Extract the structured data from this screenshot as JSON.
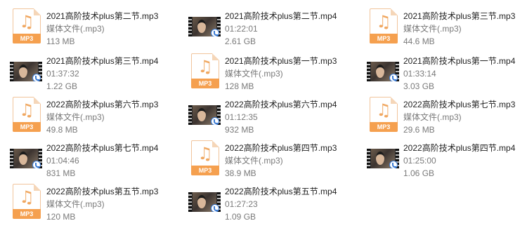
{
  "files": [
    {
      "name": "2021高阶技术plus第二节.mp3",
      "detail": "媒体文件(.mp3)",
      "size": "113 MB",
      "kind": "mp3",
      "icon_label": "MP3"
    },
    {
      "name": "2021高阶技术plus第二节.mp4",
      "detail": "01:22:01",
      "size": "2.61 GB",
      "kind": "mp4"
    },
    {
      "name": "2021高阶技术plus第三节.mp3",
      "detail": "媒体文件(.mp3)",
      "size": "44.6 MB",
      "kind": "mp3",
      "icon_label": "MP3"
    },
    {
      "name": "2021高阶技术plus第三节.mp4",
      "detail": "01:37:32",
      "size": "1.22 GB",
      "kind": "mp4"
    },
    {
      "name": "2021高阶技术plus第一节.mp3",
      "detail": "媒体文件(.mp3)",
      "size": "128 MB",
      "kind": "mp3",
      "icon_label": "MP3"
    },
    {
      "name": "2021高阶技术plus第一节.mp4",
      "detail": "01:33:14",
      "size": "3.03 GB",
      "kind": "mp4"
    },
    {
      "name": "2022高阶技术plus第六节.mp3",
      "detail": "媒体文件(.mp3)",
      "size": "49.8 MB",
      "kind": "mp3",
      "icon_label": "MP3"
    },
    {
      "name": "2022高阶技术plus第六节.mp4",
      "detail": "01:12:35",
      "size": "932 MB",
      "kind": "mp4"
    },
    {
      "name": "2022高阶技术plus第七节.mp3",
      "detail": "媒体文件(.mp3)",
      "size": "29.6 MB",
      "kind": "mp3",
      "icon_label": "MP3"
    },
    {
      "name": "2022高阶技术plus第七节.mp4",
      "detail": "01:04:46",
      "size": "831 MB",
      "kind": "mp4"
    },
    {
      "name": "2022高阶技术plus第四节.mp3",
      "detail": "媒体文件(.mp3)",
      "size": "38.9 MB",
      "kind": "mp3",
      "icon_label": "MP3"
    },
    {
      "name": "2022高阶技术plus第四节.mp4",
      "detail": "01:25:00",
      "size": "1.06 GB",
      "kind": "mp4"
    },
    {
      "name": "2022高阶技术plus第五节.mp3",
      "detail": "媒体文件(.mp3)",
      "size": "120 MB",
      "kind": "mp3",
      "icon_label": "MP3"
    },
    {
      "name": "2022高阶技术plus第五节.mp4",
      "detail": "01:27:23",
      "size": "1.09 GB",
      "kind": "mp4"
    }
  ]
}
